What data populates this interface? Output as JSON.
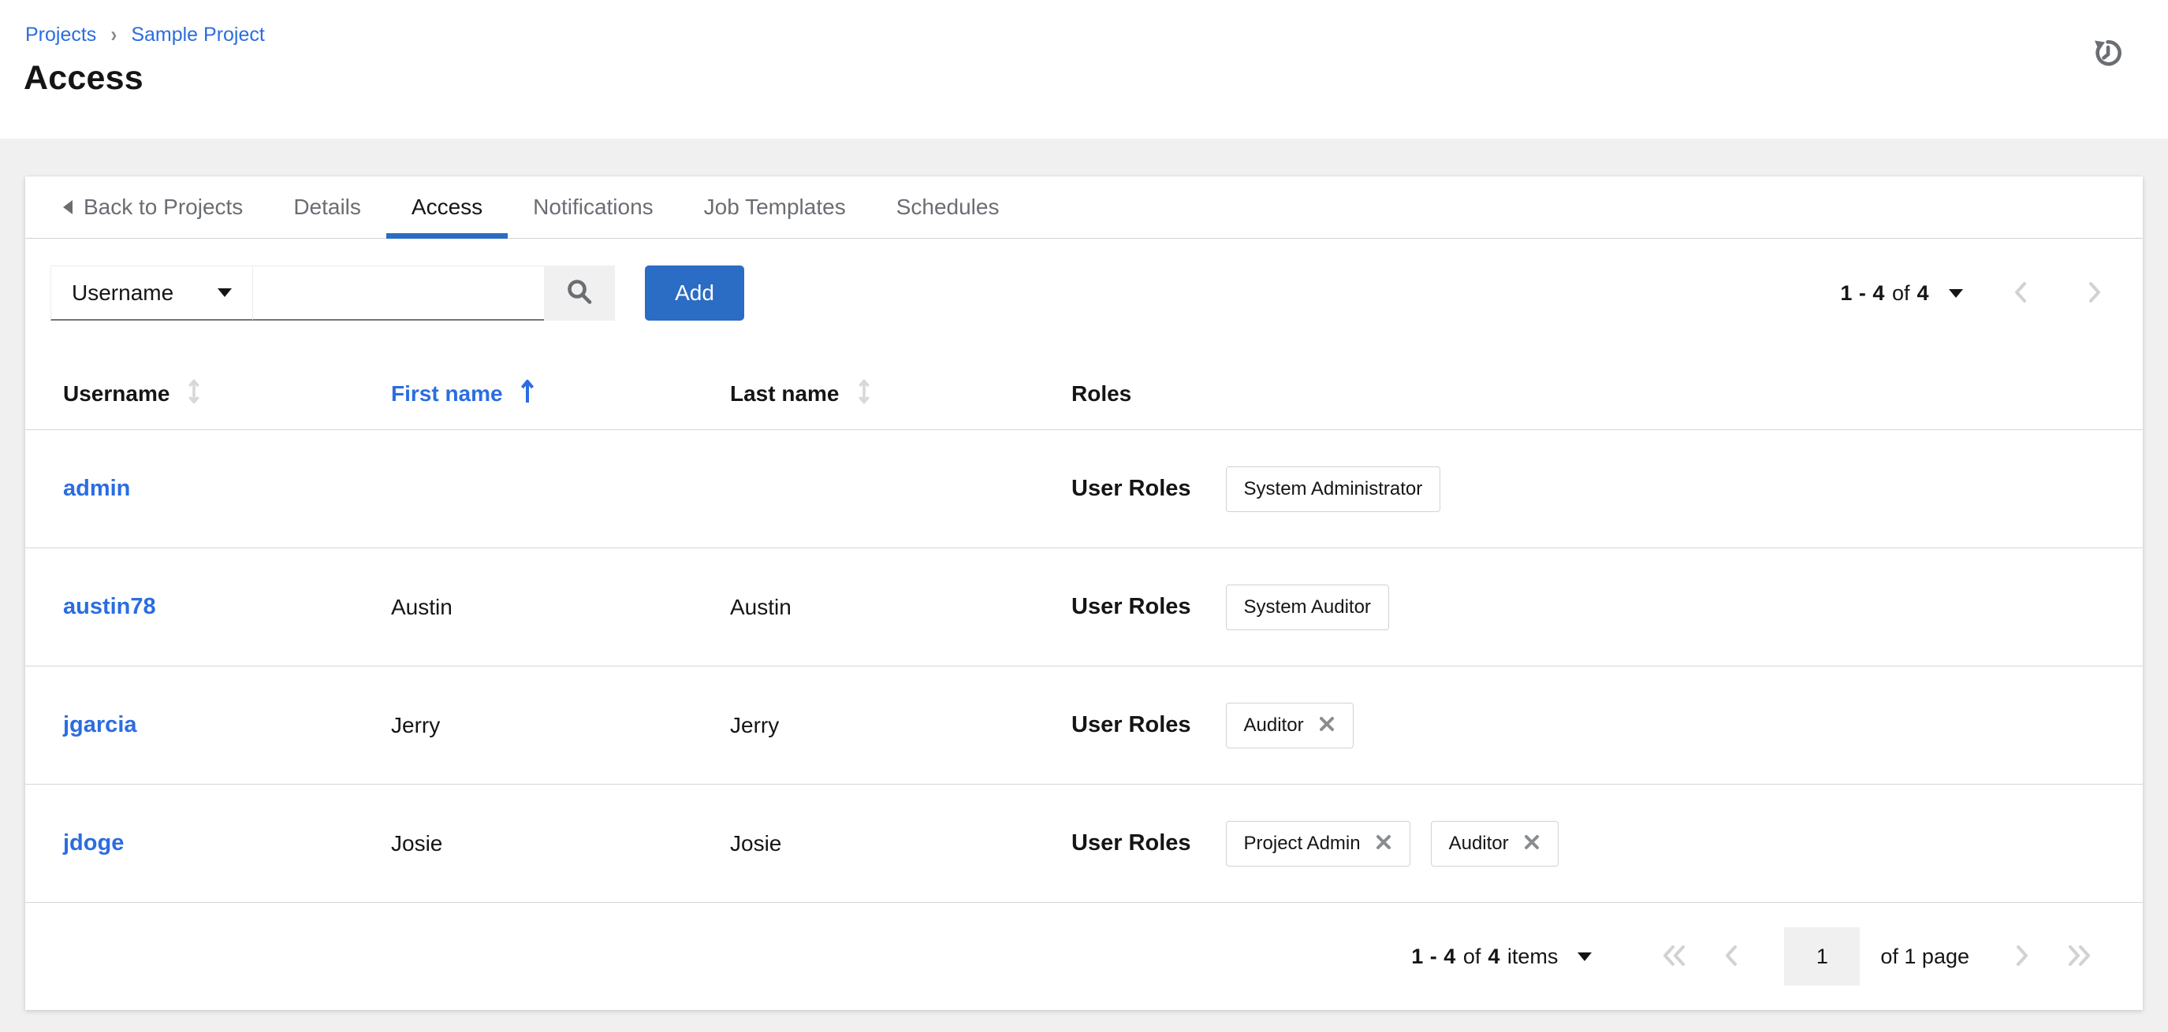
{
  "breadcrumb": {
    "items": [
      {
        "label": "Projects"
      },
      {
        "label": "Sample Project"
      }
    ]
  },
  "page": {
    "title": "Access"
  },
  "header": {
    "history_icon": "history-icon"
  },
  "tabs": {
    "back_label": "Back to Projects",
    "items": [
      "Details",
      "Access",
      "Notifications",
      "Job Templates",
      "Schedules"
    ],
    "active": "Access"
  },
  "toolbar": {
    "filter_key": "Username",
    "search_value": "",
    "search_placeholder": "",
    "add_label": "Add"
  },
  "pagination_top": {
    "range": "1 - 4",
    "of": "of",
    "total": "4"
  },
  "table": {
    "columns": [
      {
        "label": "Username",
        "sort": "unsorted"
      },
      {
        "label": "First name",
        "sort": "ascending"
      },
      {
        "label": "Last name",
        "sort": "unsorted"
      },
      {
        "label": "Roles",
        "sort": "none"
      }
    ],
    "roles_label": "User Roles",
    "rows": [
      {
        "username": "admin",
        "first_name": "",
        "last_name": "",
        "roles": [
          {
            "name": "System Administrator",
            "removable": false
          }
        ]
      },
      {
        "username": "austin78",
        "first_name": "Austin",
        "last_name": "Austin",
        "roles": [
          {
            "name": "System Auditor",
            "removable": false
          }
        ]
      },
      {
        "username": "jgarcia",
        "first_name": "Jerry",
        "last_name": "Jerry",
        "roles": [
          {
            "name": "Auditor",
            "removable": true
          }
        ]
      },
      {
        "username": "jdoge",
        "first_name": "Josie",
        "last_name": "Josie",
        "roles": [
          {
            "name": "Project Admin",
            "removable": true
          },
          {
            "name": "Auditor",
            "removable": true
          }
        ]
      }
    ]
  },
  "pagination_bottom": {
    "range": "1 - 4",
    "of": "of",
    "total": "4",
    "items_label": "items",
    "page_value": "1",
    "of_page_label": "of 1 page"
  },
  "icons": {
    "header_right": "history-icon",
    "back_tab": "caret-left-icon",
    "filter": "caret-down-icon",
    "search": "search-icon",
    "sort_unsorted": "arrows-up-down-icon",
    "sort_ascending": "long-arrow-up-icon",
    "chip_remove": "times-icon",
    "nav": [
      "angle-double-left-icon",
      "angle-left-icon",
      "angle-right-icon",
      "angle-double-right-icon"
    ]
  },
  "colors": {
    "link": "#2b6de0",
    "primary": "#2b6cc4",
    "text": "#151515",
    "muted": "#6a6e73",
    "border_light": "#d7d7d7",
    "chip_border": "#d2d2d2",
    "disabled": "#d2d2d2",
    "page_bg": "#f0f0f0",
    "input_border_bottom": "#72767b"
  }
}
